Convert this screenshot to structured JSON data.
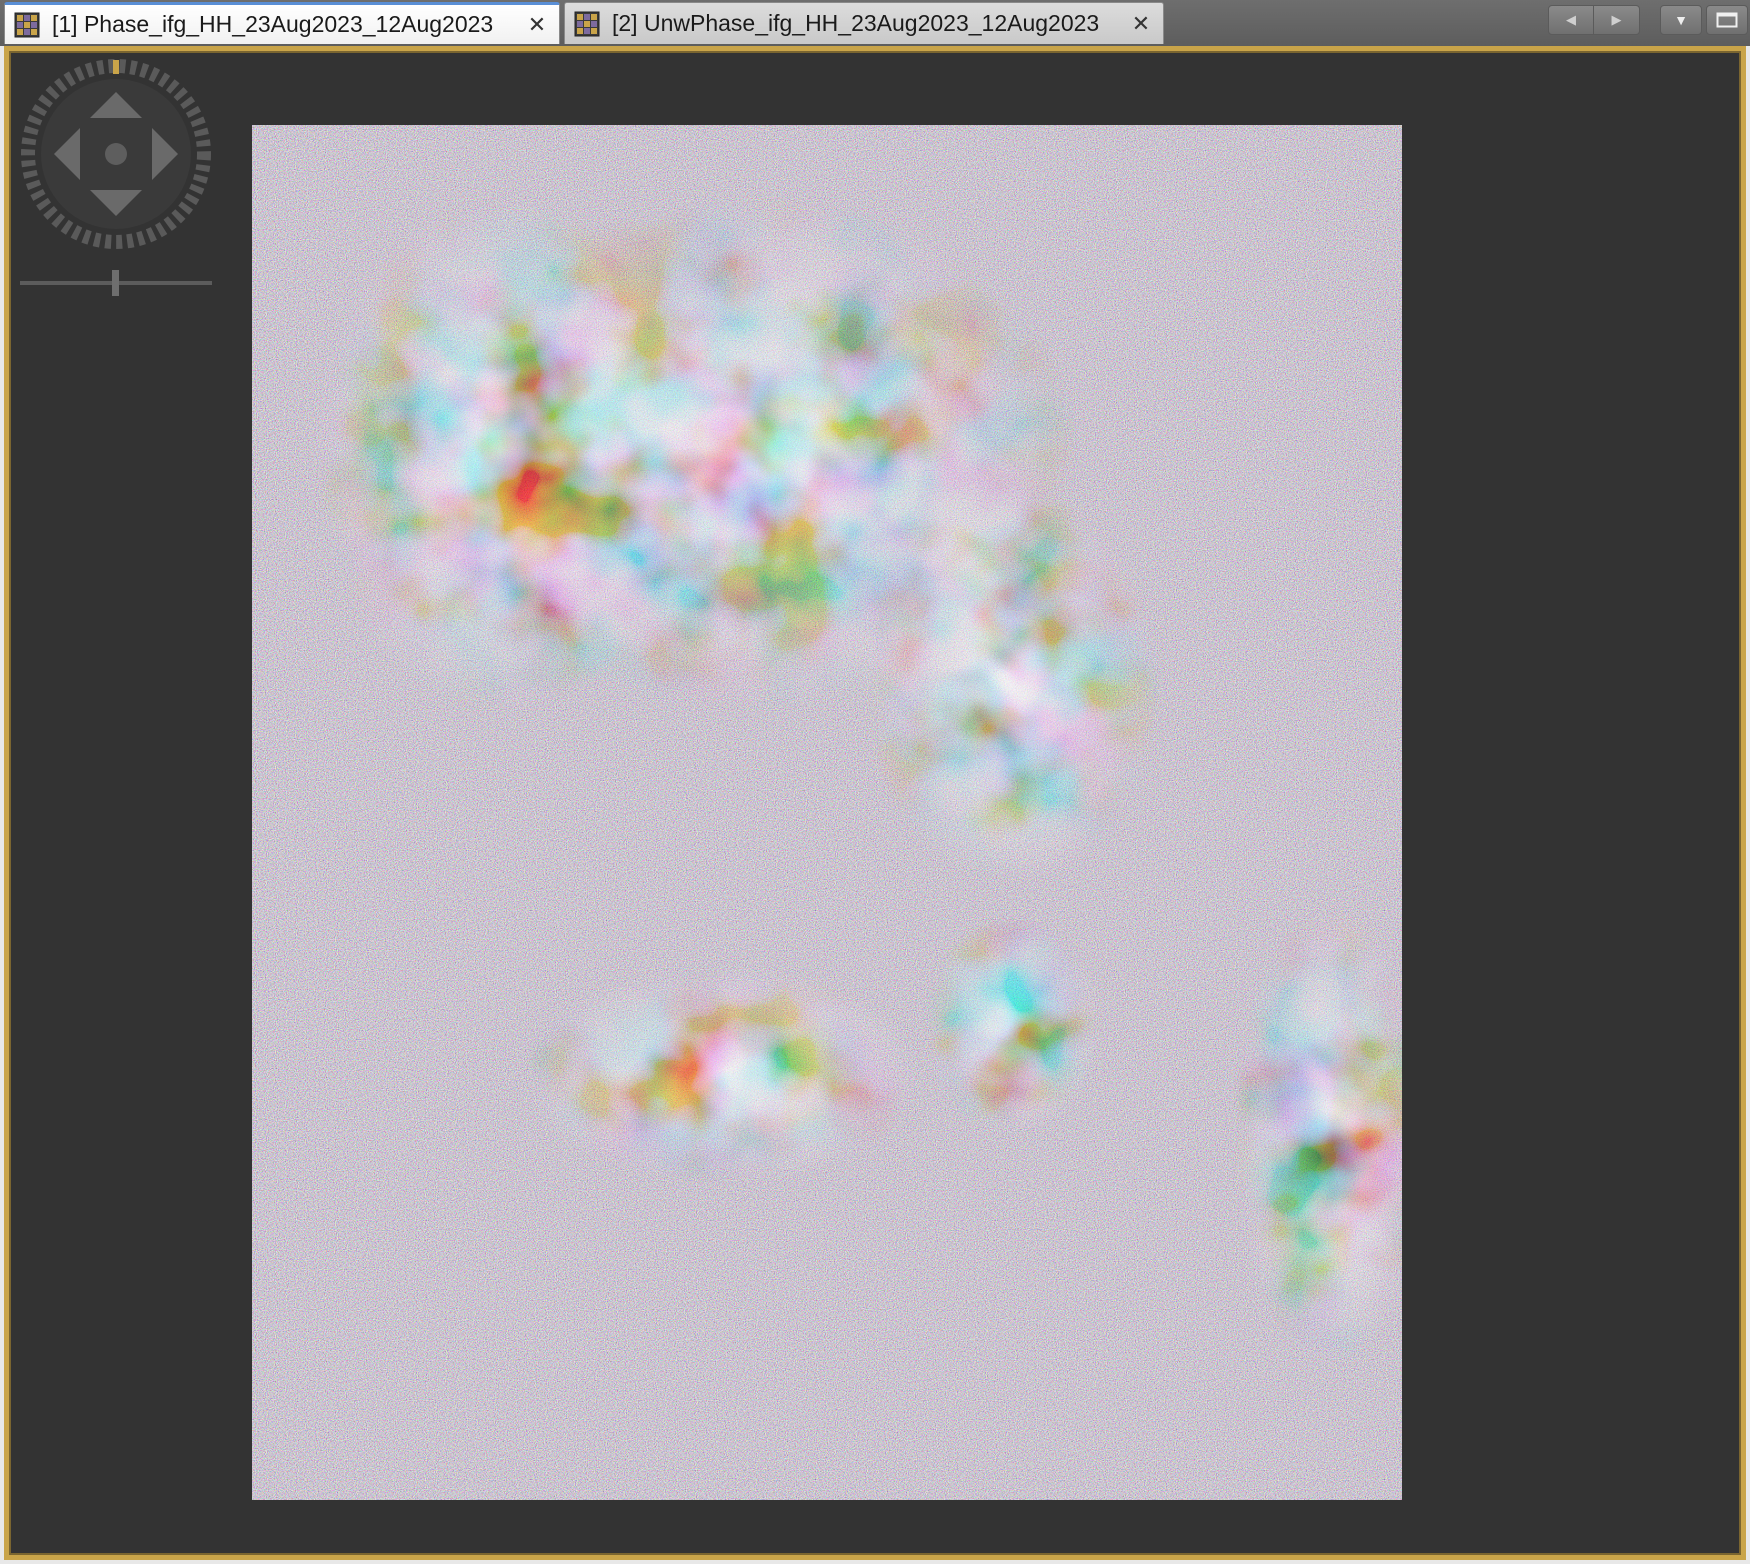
{
  "tabs": [
    {
      "label": "[1] Phase_ifg_HH_23Aug2023_12Aug2023",
      "active": true,
      "icon": "raster-image-icon",
      "close": "✕"
    },
    {
      "label": "[2] UnwPhase_ifg_HH_23Aug2023_12Aug2023",
      "active": false,
      "icon": "raster-image-icon",
      "close": "✕"
    }
  ],
  "toolbar": {
    "prev_icon": "◀",
    "next_icon": "▶",
    "dropdown_icon": "▼",
    "maximize_icon": "maximize-icon"
  },
  "viewer": {
    "frame_color": "#c9a449",
    "background_color": "#333333",
    "navigation_control": "pan-wheel",
    "image_type": "wrapped interferometric phase (rainbow colormap)"
  }
}
